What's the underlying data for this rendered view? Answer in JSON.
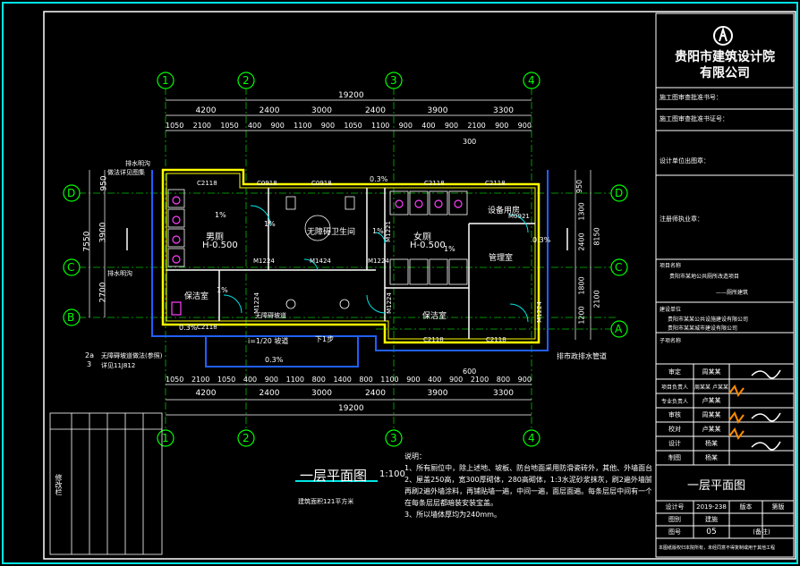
{
  "colors": {
    "background": "#000000",
    "frame": "#00e5e5",
    "wall": "#ffff00",
    "dim": "#ffffff",
    "grid": "#00ff00",
    "red": "#ff3030",
    "accent": "#ff8c00"
  },
  "grid_axes": {
    "vertical": [
      "1",
      "2",
      "3",
      "4"
    ],
    "horizontal": [
      "D",
      "C",
      "B",
      "A"
    ]
  },
  "dims_top": {
    "total": "19200",
    "row1": [
      "4200",
      "2400",
      "3000",
      "2400",
      "3900",
      "3300"
    ],
    "row2": [
      "1050",
      "2100",
      "1050",
      "400",
      "900",
      "1100",
      "900",
      "1050",
      "1100",
      "900",
      "400",
      "900",
      "2100",
      "900",
      "900"
    ],
    "row3": "300"
  },
  "dims_bottom": {
    "total": "19200",
    "row1": [
      "4200",
      "2400",
      "3000",
      "2400",
      "3900",
      "3300"
    ],
    "row2": [
      "1050",
      "2100",
      "1050",
      "400",
      "900",
      "1100",
      "800",
      "1400",
      "800",
      "1100",
      "900",
      "400",
      "900",
      "2100",
      "800",
      "900"
    ],
    "row3": "600"
  },
  "dims_left": {
    "a": "950",
    "b": "3900",
    "c": "2700",
    "total": "7550"
  },
  "dims_right": {
    "a": "950",
    "b": "1300",
    "c": "2400",
    "d": "1800",
    "e": "1200",
    "f": "2100",
    "total": "8150"
  },
  "rooms": {
    "men": "男厕",
    "men_h": "H-0.500",
    "accessible": "无障碍卫生间",
    "women": "女厕",
    "women_h": "H-0.500",
    "equipment": "设备用房",
    "manage": "管理室",
    "janitor": "保洁室",
    "cleaning": "保洁室"
  },
  "doors": [
    "C2118",
    "C0918",
    "C0918",
    "C2118",
    "C2118",
    "M0921",
    "M1224",
    "M1424",
    "M1224",
    "M1221",
    "M1224",
    "M1224",
    "M1224",
    "C2118",
    "C2118",
    "C2118"
  ],
  "slopes": [
    "0.3%",
    "1%",
    "1%",
    "1%",
    "1%",
    "1%",
    "0.3%",
    "0.3%",
    "0.3%"
  ],
  "labels": {
    "drain_top": "排水明沟",
    "drain_top2": "做法详见图集",
    "drain_left": "排水明沟",
    "drain_right": "排市政排水管道",
    "ramp": "i=1/20 坡道",
    "ramp_note": "无障碍坡道",
    "step": "下1步",
    "ref1": "2a",
    "ref2": "3",
    "ref_note": "无障碍坡道做法(参照)",
    "ref_note2": "详见11J812"
  },
  "plan_title": {
    "text": "一层平面图",
    "scale": "1:100",
    "note": "建筑面积121平方米"
  },
  "notes": {
    "head": "说明：",
    "items": [
      "1、所有厕位中，除上述地、坡板、防台地面采用防滑瓷砖外，其他、外墙面台面处理均采用涂料处理。",
      "2、屋盖250高，宽300厚砌体，280高砌体，1:3水泥砂浆抹灰，刷2遍外墙腻子，",
      "   再刷2遍外墙涂料，再铺贴墙一遍，中间一遍，面层面遍。每条层层中间有一个宝盖，",
      "   在每条层层都暗装安装宝盖。",
      "3、所以墙体厚均为240mm。"
    ]
  },
  "title_block": {
    "company1": "贵阳市建筑设计院",
    "company2": "有限公司",
    "rows": [
      "施工图审查批准书号：",
      "施工图审查批准书证号：",
      "设计单位出图章：",
      "注册师执业章："
    ],
    "project_label": "项目名称",
    "project_name": "贵阳市某地公共厕所改造项目",
    "project_sub": "——厕所建筑",
    "client_label": "建设单位",
    "client_name": "贵阳市某某公共设施建设有限公司",
    "client_name2": "贵阳市某某城市建设有限公司",
    "sub_label": "子项名称",
    "roles": [
      {
        "role": "审定",
        "name": "周某某"
      },
      {
        "role": "项目负责人",
        "name": "周某某 卢某某"
      },
      {
        "role": "专业负责人",
        "name": "卢某某"
      },
      {
        "role": "审核",
        "name": "周某某"
      },
      {
        "role": "校对",
        "name": "卢某某"
      },
      {
        "role": "设计",
        "name": "杨某"
      },
      {
        "role": "制图",
        "name": "杨某"
      }
    ],
    "drawing_title": "一层平面图",
    "info": [
      {
        "k": "设计号",
        "v": "2019-238",
        "k2": "版本",
        "v2": "第版"
      },
      {
        "k": "图别",
        "v": "建施",
        "k2": "",
        "v2": ""
      },
      {
        "k": "图号",
        "v": "05",
        "k2": "(备注)",
        "v2": ""
      }
    ],
    "footer": "本图纸版权归本院所有，未经同意不得复制或用于其他工程"
  },
  "revision_table": {
    "label": "修改栏"
  }
}
